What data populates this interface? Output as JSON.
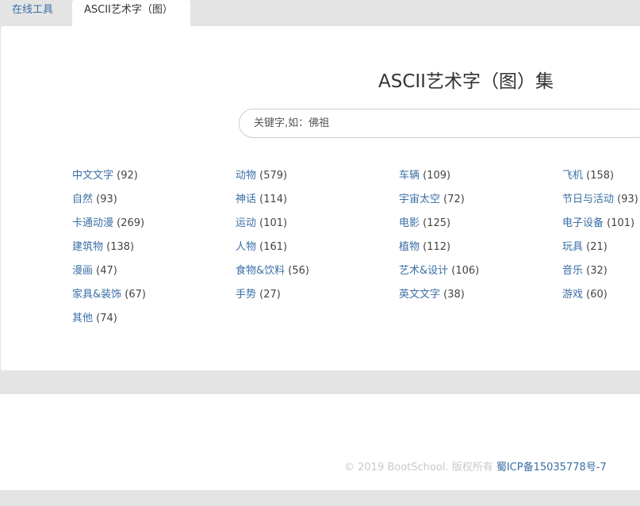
{
  "tabs": [
    {
      "label": "在线工具"
    },
    {
      "label": "ASCII艺术字（图）"
    }
  ],
  "page_title": "ASCII艺术字（图）集",
  "search": {
    "placeholder": "关键字,如：佛祖"
  },
  "categories": [
    {
      "name": "中文文字",
      "count": "(92)"
    },
    {
      "name": "动物",
      "count": "(579)"
    },
    {
      "name": "车辆",
      "count": "(109)"
    },
    {
      "name": "飞机",
      "count": "(158)"
    },
    {
      "name": "自然",
      "count": "(93)"
    },
    {
      "name": "神话",
      "count": "(114)"
    },
    {
      "name": "宇宙太空",
      "count": "(72)"
    },
    {
      "name": "节日与活动",
      "count": "(93)"
    },
    {
      "name": "卡通动漫",
      "count": "(269)"
    },
    {
      "name": "运动",
      "count": "(101)"
    },
    {
      "name": "电影",
      "count": "(125)"
    },
    {
      "name": "电子设备",
      "count": "(101)"
    },
    {
      "name": "建筑物",
      "count": "(138)"
    },
    {
      "name": "人物",
      "count": "(161)"
    },
    {
      "name": "植物",
      "count": "(112)"
    },
    {
      "name": "玩具",
      "count": "(21)"
    },
    {
      "name": "漫画",
      "count": "(47)"
    },
    {
      "name": "食物&饮料",
      "count": "(56)"
    },
    {
      "name": "艺术&设计",
      "count": "(106)"
    },
    {
      "name": "音乐",
      "count": "(32)"
    },
    {
      "name": "家具&装饰",
      "count": "(67)"
    },
    {
      "name": "手势",
      "count": "(27)"
    },
    {
      "name": "英文文字",
      "count": "(38)"
    },
    {
      "name": "游戏",
      "count": "(60)"
    },
    {
      "name": "其他",
      "count": "(74)"
    }
  ],
  "footer": {
    "copyright": "© 2019 BootSchool. 版权所有",
    "icp": "蜀ICP备15035778号-7"
  }
}
